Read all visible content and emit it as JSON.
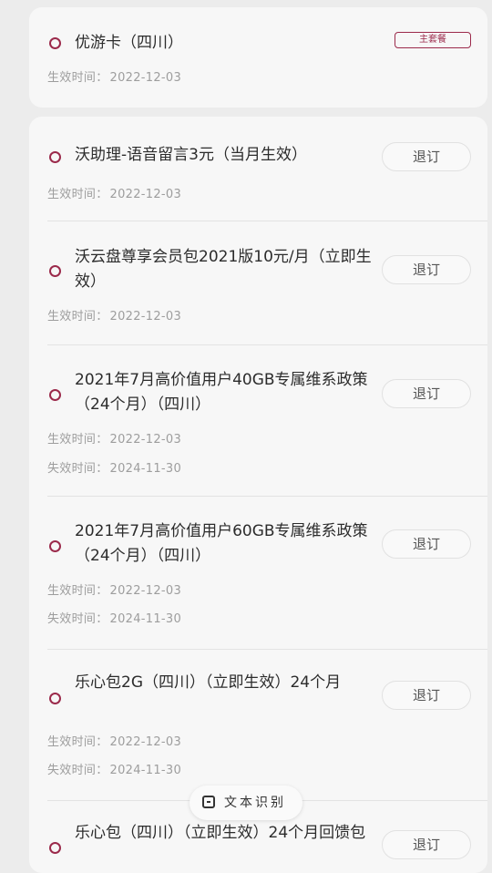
{
  "main_plan": {
    "name": "优游卡（四川）",
    "badge": "主套餐",
    "effective_label": "生效时间：",
    "effective_date": "2022-12-03"
  },
  "labels": {
    "effective": "生效时间：",
    "expire": "失效时间：",
    "unsubscribe": "退订"
  },
  "services": [
    {
      "name": "沃助理-语音留言3元（当月生效）",
      "effective": "2022-12-03",
      "expire": ""
    },
    {
      "name": "沃云盘尊享会员包2021版10元/月（立即生效）",
      "effective": "2022-12-03",
      "expire": ""
    },
    {
      "name": "2021年7月高价值用户40GB专属维系政策（24个月）（四川）",
      "effective": "2022-12-03",
      "expire": "2024-11-30"
    },
    {
      "name": "2021年7月高价值用户60GB专属维系政策（24个月）（四川）",
      "effective": "2022-12-03",
      "expire": "2024-11-30"
    },
    {
      "name": "乐心包2G（四川）（立即生效）24个月",
      "effective": "2022-12-03",
      "expire": "2024-11-30"
    },
    {
      "name": "乐心包（四川）（立即生效）24个月回馈包",
      "effective": "",
      "expire": ""
    }
  ],
  "ocr_button": {
    "label": "文本识别"
  },
  "colors": {
    "accent": "#9b2a4b",
    "background": "#ececec",
    "card": "#f7f7f7"
  }
}
